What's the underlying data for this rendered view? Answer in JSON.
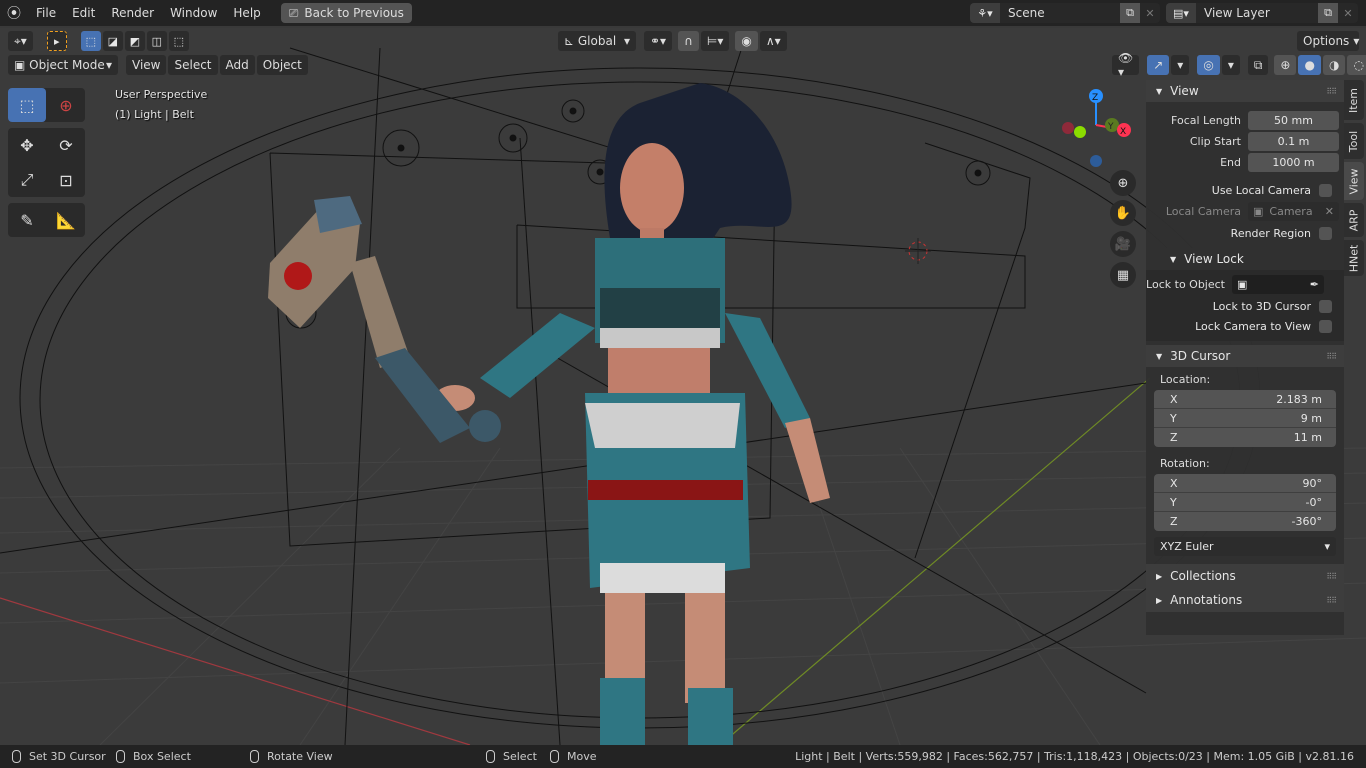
{
  "topbar": {
    "menus": [
      "File",
      "Edit",
      "Render",
      "Window",
      "Help"
    ],
    "back_button": "Back to Previous",
    "scene": {
      "name": "Scene"
    },
    "view_layer": {
      "name": "View Layer"
    }
  },
  "viewport_header": {
    "mode": "Object Mode",
    "menus": [
      "View",
      "Select",
      "Add",
      "Object"
    ],
    "transform_orientation": "Global",
    "options_label": "Options"
  },
  "viewport_info": {
    "perspective": "User Perspective",
    "selection": "(1) Light | Belt"
  },
  "gizmo": {
    "x_label": "X",
    "y_label": "Y",
    "z_label": "Z",
    "x_color": "#ff3352",
    "y_color": "#8bdc00",
    "z_color": "#2890ff"
  },
  "n_panel": {
    "view": {
      "title": "View",
      "focal_length_label": "Focal Length",
      "focal_length": "50 mm",
      "clip_start_label": "Clip Start",
      "clip_start": "0.1 m",
      "clip_end_label": "End",
      "clip_end": "1000 m",
      "use_local_camera_label": "Use Local Camera",
      "local_camera_label": "Local Camera",
      "local_camera_value": "Camera",
      "render_region_label": "Render Region"
    },
    "view_lock": {
      "title": "View Lock",
      "lock_object_label": "Lock to Object",
      "lock_cursor_label": "Lock to 3D Cursor",
      "lock_camera_label": "Lock Camera to View"
    },
    "cursor": {
      "title": "3D Cursor",
      "location_label": "Location:",
      "location": [
        {
          "axis": "X",
          "value": "2.183 m"
        },
        {
          "axis": "Y",
          "value": "9 m"
        },
        {
          "axis": "Z",
          "value": "11 m"
        }
      ],
      "rotation_label": "Rotation:",
      "rotation": [
        {
          "axis": "X",
          "value": "90°"
        },
        {
          "axis": "Y",
          "value": "-0°"
        },
        {
          "axis": "Z",
          "value": "-360°"
        }
      ],
      "rotation_mode": "XYZ Euler"
    },
    "collections": {
      "title": "Collections"
    },
    "annotations": {
      "title": "Annotations"
    },
    "tabs": [
      "Item",
      "Tool",
      "View",
      "ARP",
      "HNet"
    ],
    "active_tab": "View"
  },
  "statusbar": {
    "left": [
      {
        "label": "Set 3D Cursor"
      },
      {
        "label": "Box Select"
      },
      {
        "label": "Rotate View"
      },
      {
        "label": "Select"
      },
      {
        "label": "Move"
      }
    ],
    "stats": "Light | Belt | Verts:559,982 | Faces:562,757 | Tris:1,118,423 | Objects:0/23 | Mem: 1.05 GiB | v2.81.16"
  },
  "colors": {
    "accent": "#4772b3",
    "background": "#393939",
    "panel": "#303030"
  }
}
